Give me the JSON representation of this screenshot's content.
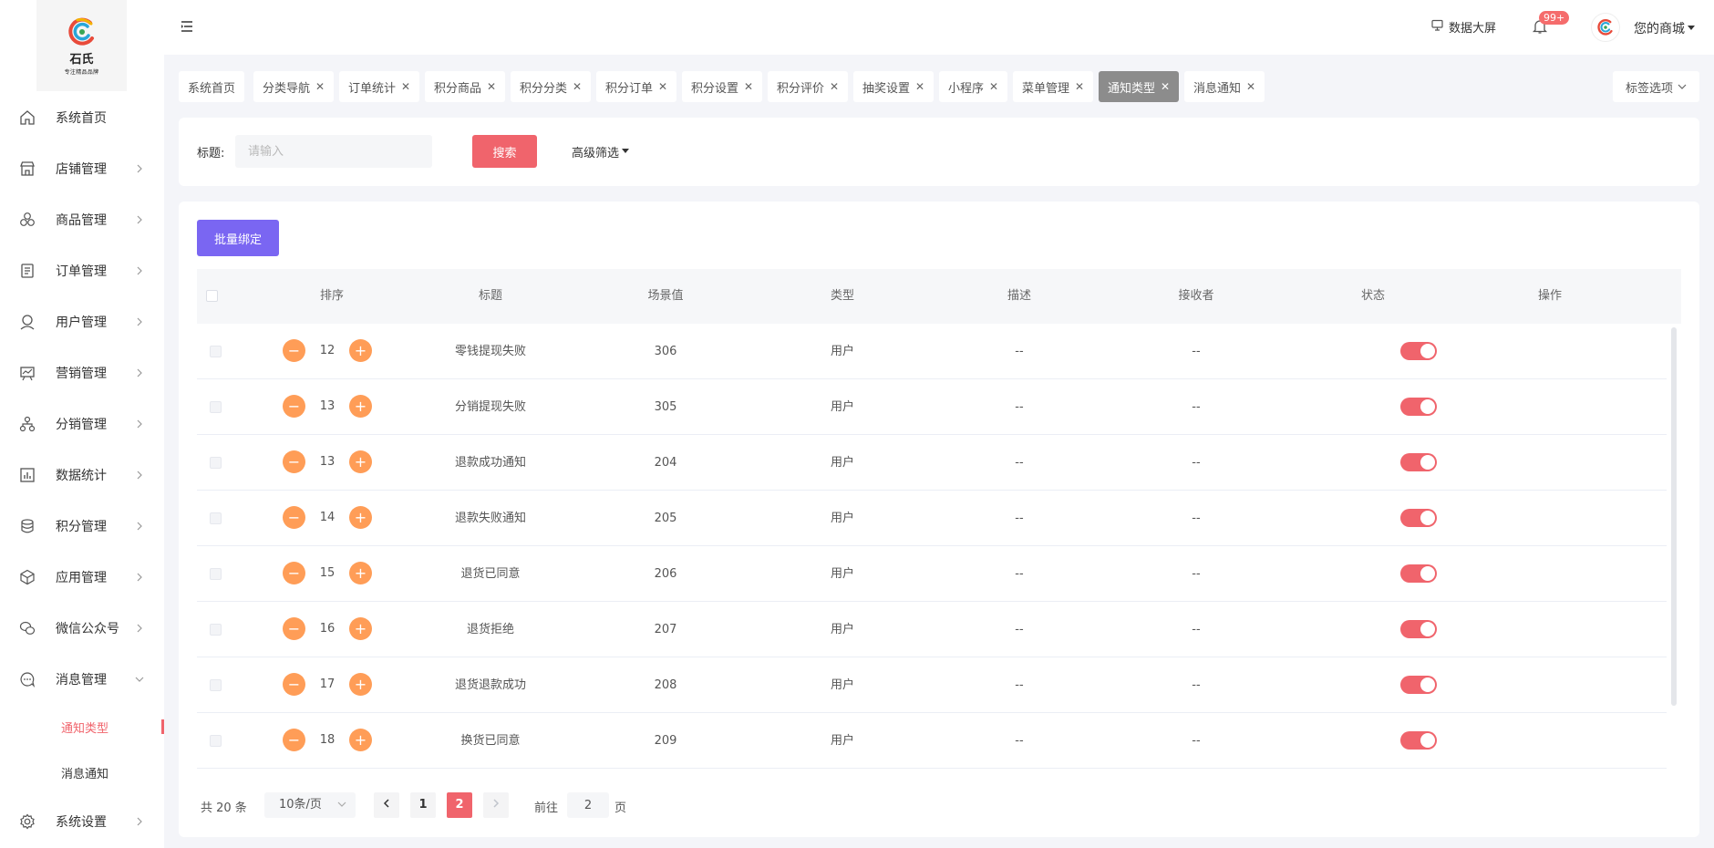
{
  "brand": {
    "name": "石氏",
    "tagline": "专注精品品牌",
    "accent": "#f0646c"
  },
  "sidebar": {
    "items": [
      {
        "label": "系统首页",
        "icon": "home-icon"
      },
      {
        "label": "店铺管理",
        "icon": "store-icon"
      },
      {
        "label": "商品管理",
        "icon": "goods-icon"
      },
      {
        "label": "订单管理",
        "icon": "order-icon"
      },
      {
        "label": "用户管理",
        "icon": "user-icon"
      },
      {
        "label": "营销管理",
        "icon": "marketing-icon"
      },
      {
        "label": "分销管理",
        "icon": "distribution-icon"
      },
      {
        "label": "数据统计",
        "icon": "chart-icon"
      },
      {
        "label": "积分管理",
        "icon": "points-icon"
      },
      {
        "label": "应用管理",
        "icon": "apps-icon"
      },
      {
        "label": "微信公众号",
        "icon": "wechat-icon"
      },
      {
        "label": "消息管理",
        "icon": "message-icon"
      }
    ],
    "sub_items": [
      {
        "label": "通知类型",
        "active": true
      },
      {
        "label": "消息通知",
        "active": false
      }
    ],
    "settings_label": "系统设置"
  },
  "header": {
    "big_screen": "数据大屏",
    "badge": "99+",
    "shop": "您的商城"
  },
  "tabs": [
    {
      "label": "系统首页",
      "closable": false
    },
    {
      "label": "分类导航",
      "closable": true
    },
    {
      "label": "订单统计",
      "closable": true
    },
    {
      "label": "积分商品",
      "closable": true
    },
    {
      "label": "积分分类",
      "closable": true
    },
    {
      "label": "积分订单",
      "closable": true
    },
    {
      "label": "积分设置",
      "closable": true
    },
    {
      "label": "积分评价",
      "closable": true
    },
    {
      "label": "抽奖设置",
      "closable": true
    },
    {
      "label": "小程序",
      "closable": true
    },
    {
      "label": "菜单管理",
      "closable": true
    },
    {
      "label": "通知类型",
      "closable": true,
      "active": true
    },
    {
      "label": "消息通知",
      "closable": true
    }
  ],
  "tab_options": "标签选项",
  "search": {
    "label": "标题:",
    "placeholder": "请输入",
    "button": "搜索",
    "advanced": "高级筛选"
  },
  "table": {
    "bind_button": "批量绑定",
    "columns": [
      "排序",
      "标题",
      "场景值",
      "类型",
      "描述",
      "接收者",
      "状态",
      "操作"
    ],
    "rows": [
      {
        "sort": "12",
        "title": "零钱提现失败",
        "scene": "306",
        "type": "用户",
        "desc": "--",
        "receiver": "--",
        "status": true
      },
      {
        "sort": "13",
        "title": "分销提现失败",
        "scene": "305",
        "type": "用户",
        "desc": "--",
        "receiver": "--",
        "status": true
      },
      {
        "sort": "13",
        "title": "退款成功通知",
        "scene": "204",
        "type": "用户",
        "desc": "--",
        "receiver": "--",
        "status": true
      },
      {
        "sort": "14",
        "title": "退款失败通知",
        "scene": "205",
        "type": "用户",
        "desc": "--",
        "receiver": "--",
        "status": true
      },
      {
        "sort": "15",
        "title": "退货已同意",
        "scene": "206",
        "type": "用户",
        "desc": "--",
        "receiver": "--",
        "status": true
      },
      {
        "sort": "16",
        "title": "退货拒绝",
        "scene": "207",
        "type": "用户",
        "desc": "--",
        "receiver": "--",
        "status": true
      },
      {
        "sort": "17",
        "title": "退货退款成功",
        "scene": "208",
        "type": "用户",
        "desc": "--",
        "receiver": "--",
        "status": true
      },
      {
        "sort": "18",
        "title": "换货已同意",
        "scene": "209",
        "type": "用户",
        "desc": "--",
        "receiver": "--",
        "status": true
      }
    ]
  },
  "pagination": {
    "total": "共 20 条",
    "page_size": "10条/页",
    "pages": [
      "1",
      "2"
    ],
    "current": "2",
    "goto_label": "前往",
    "goto_value": "2",
    "page_suffix": "页"
  }
}
